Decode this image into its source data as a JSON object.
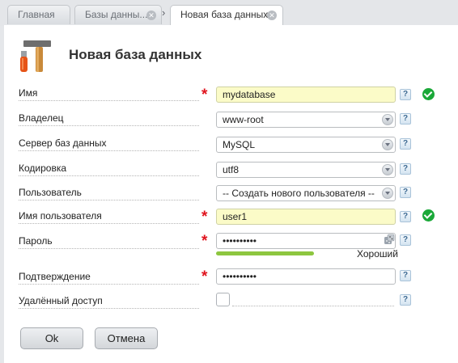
{
  "tabs": [
    {
      "label": "Главная",
      "active": false,
      "closable": false
    },
    {
      "label": "Базы данны...",
      "active": false,
      "closable": true
    },
    {
      "label": "Новая база данных",
      "active": true,
      "closable": true
    }
  ],
  "header": {
    "title": "Новая база данных",
    "icon": "tools-icon"
  },
  "form": {
    "name": {
      "label": "Имя",
      "value": "mydatabase",
      "required": true,
      "valid": true
    },
    "owner": {
      "label": "Владелец",
      "value": "www-root"
    },
    "server": {
      "label": "Сервер баз данных",
      "value": "MySQL"
    },
    "encoding": {
      "label": "Кодировка",
      "value": "utf8"
    },
    "user": {
      "label": "Пользователь",
      "value": "-- Создать нового пользователя --"
    },
    "username": {
      "label": "Имя пользователя",
      "value": "user1",
      "required": true,
      "valid": true
    },
    "password": {
      "label": "Пароль",
      "value": "••••••••••",
      "required": true,
      "strength_label": "Хороший",
      "strength_color": "#8dc63f"
    },
    "confirm": {
      "label": "Подтверждение",
      "value": "••••••••••",
      "required": true
    },
    "remote_access": {
      "label": "Удалённый доступ",
      "checked": false
    }
  },
  "help_glyph": "?",
  "required_glyph": "*",
  "buttons": {
    "ok": "Ok",
    "cancel": "Отмена"
  },
  "colors": {
    "required": "#e0141e",
    "valid": "#1aa838",
    "highlight_field": "#fbfbc8"
  }
}
